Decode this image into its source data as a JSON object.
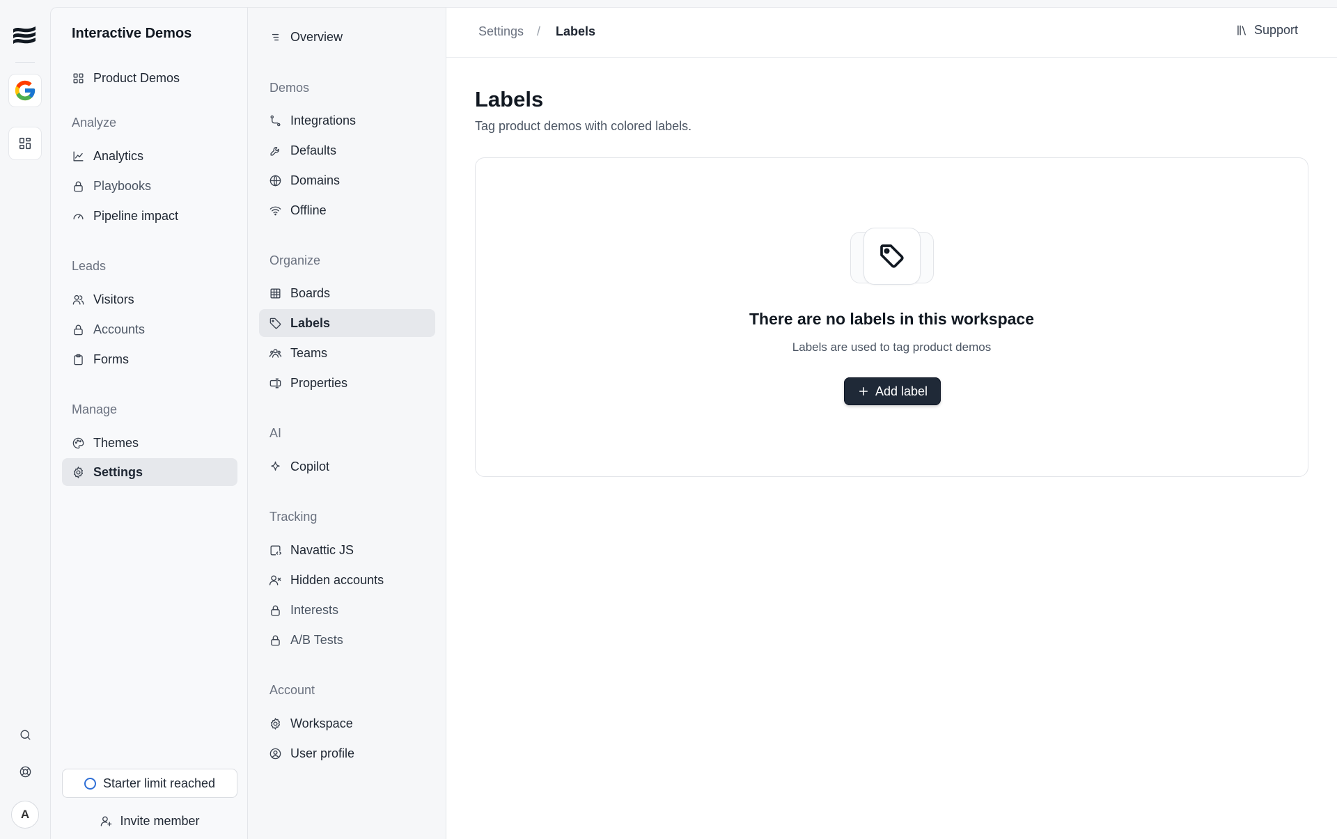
{
  "rail": {
    "avatar_initial": "A",
    "icons": [
      "navattic-logo-icon",
      "google-icon",
      "apps-grid-icon",
      "search-icon",
      "help-lifebuoy-icon"
    ]
  },
  "sidebar": {
    "title": "Interactive Demos",
    "top_item": "Product Demos",
    "sections": {
      "analyze": "Analyze",
      "leads": "Leads",
      "manage": "Manage"
    },
    "items": {
      "analytics": "Analytics",
      "playbooks": "Playbooks",
      "pipeline": "Pipeline impact",
      "visitors": "Visitors",
      "accounts": "Accounts",
      "forms": "Forms",
      "themes": "Themes",
      "settings": "Settings"
    },
    "active": "Settings",
    "limit_label": "Starter limit reached",
    "invite_label": "Invite member"
  },
  "subnav": {
    "overview": "Overview",
    "sections": {
      "demos": "Demos",
      "organize": "Organize",
      "ai": "AI",
      "tracking": "Tracking",
      "account": "Account"
    },
    "items": {
      "integrations": "Integrations",
      "defaults": "Defaults",
      "domains": "Domains",
      "offline": "Offline",
      "boards": "Boards",
      "labels": "Labels",
      "teams": "Teams",
      "properties": "Properties",
      "copilot": "Copilot",
      "navattic_js": "Navattic JS",
      "hidden_accounts": "Hidden accounts",
      "interests": "Interests",
      "ab_tests": "A/B Tests",
      "workspace": "Workspace",
      "user_profile": "User profile"
    },
    "active": "Labels"
  },
  "header": {
    "breadcrumb_parent": "Settings",
    "breadcrumb_sep": "/",
    "breadcrumb_current": "Labels",
    "support_label": "Support"
  },
  "main": {
    "title": "Labels",
    "subtitle": "Tag product demos with colored labels.",
    "empty": {
      "title": "There are no labels in this workspace",
      "subtitle": "Labels are used to tag product demos",
      "button": "Add label"
    }
  },
  "colors": {
    "primary_button": "#1f2937",
    "active_bg": "#e6e8ec",
    "limit_ring": "#2f6fd6"
  }
}
